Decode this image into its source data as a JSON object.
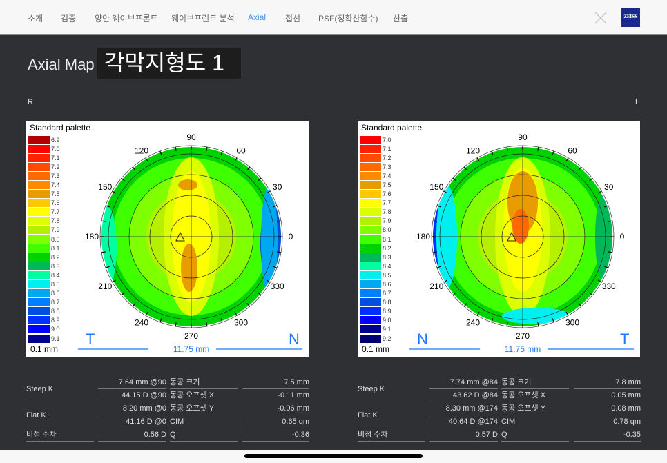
{
  "nav": {
    "tabs": [
      "소개",
      "검증",
      "양안 웨이브프론트",
      "웨이브프런트 분석",
      "Axial",
      "접선",
      "PSF(정확산함수)",
      "산출"
    ],
    "active": 4,
    "logo": "ZEISS",
    "close_icon": "close-icon"
  },
  "header": {
    "title": "Axial Map",
    "subtitle": "각막지형도 1"
  },
  "eyes": [
    {
      "side": "R",
      "palette_title": "Standard palette",
      "step": "0.1 mm",
      "left_letter": "T",
      "right_letter": "N",
      "diameter": "11.75 mm",
      "legend": [
        "6.9",
        "7.0",
        "7.1",
        "7.2",
        "7.3",
        "7.4",
        "7.5",
        "7.6",
        "7.7",
        "7.8",
        "7.9",
        "8.0",
        "8.1",
        "8.2",
        "8.3",
        "8.4",
        "8.5",
        "8.6",
        "8.7",
        "8.8",
        "8.9",
        "9.0",
        "9.1"
      ],
      "stats": {
        "steep_label": "Steep K",
        "steep_mm": "7.64 mm @90",
        "steep_d": "44.15 D @90",
        "flat_label": "Flat K",
        "flat_mm": "8.20 mm @0",
        "flat_d": "41.16 D @0",
        "astig_label": "비점 수차",
        "astig": "0.56 D",
        "pupil_size_label": "동공 크기",
        "pupil_size": "7.5 mm",
        "off_x_label": "동공 오프셋 X",
        "off_x": "-0.11 mm",
        "off_y_label": "동공 오프셋 Y",
        "off_y": "-0.06 mm",
        "cim_label": "CIM",
        "cim": "0.65 qm",
        "q_label": "Q",
        "q": "-0.36"
      }
    },
    {
      "side": "L",
      "palette_title": "Standard palette",
      "step": "0.1 mm",
      "left_letter": "N",
      "right_letter": "T",
      "diameter": "11.75 mm",
      "legend": [
        "7.0",
        "7.1",
        "7.2",
        "7.3",
        "7.4",
        "7.5",
        "7.6",
        "7.7",
        "7.8",
        "7.9",
        "8.0",
        "8.1",
        "8.2",
        "8.3",
        "8.4",
        "8.5",
        "8.6",
        "8.7",
        "8.8",
        "8.9",
        "9.0",
        "9.1",
        "9.2"
      ],
      "stats": {
        "steep_label": "Steep K",
        "steep_mm": "7.74 mm @84",
        "steep_d": "43.62 D @84",
        "flat_label": "Flat K",
        "flat_mm": "8.30 mm @174",
        "flat_d": "40.64 D @174",
        "astig_label": "비점 수차",
        "astig": "0.57 D",
        "pupil_size_label": "동공 크기",
        "pupil_size": "7.8 mm",
        "off_x_label": "동공 오프셋 X",
        "off_x": "0.05 mm",
        "off_y_label": "동공 오프셋 Y",
        "off_y": "0.08 mm",
        "cim_label": "CIM",
        "cim": "0.78 qm",
        "q_label": "Q",
        "q": "-0.35"
      }
    }
  ],
  "angles": [
    "0",
    "30",
    "60",
    "90",
    "120",
    "150",
    "180",
    "210",
    "240",
    "270",
    "300",
    "330"
  ],
  "palette_colors": {
    "6.9": "#b40000",
    "7.0": "#ff0000",
    "7.1": "#ff2200",
    "7.2": "#ff4a00",
    "7.3": "#ff6a00",
    "7.4": "#ff8a00",
    "7.5": "#e89c00",
    "7.6": "#ffc800",
    "7.7": "#ffff00",
    "7.8": "#dcff00",
    "7.9": "#b4f000",
    "8.0": "#80ff00",
    "8.1": "#40ff00",
    "8.2": "#00d200",
    "8.3": "#00b858",
    "8.4": "#00ffa0",
    "8.5": "#00f0f0",
    "8.6": "#00a8f0",
    "8.7": "#0080ff",
    "8.8": "#0050e0",
    "8.9": "#0030ff",
    "9.0": "#0000ff",
    "9.1": "#000090",
    "9.2": "#000070"
  }
}
